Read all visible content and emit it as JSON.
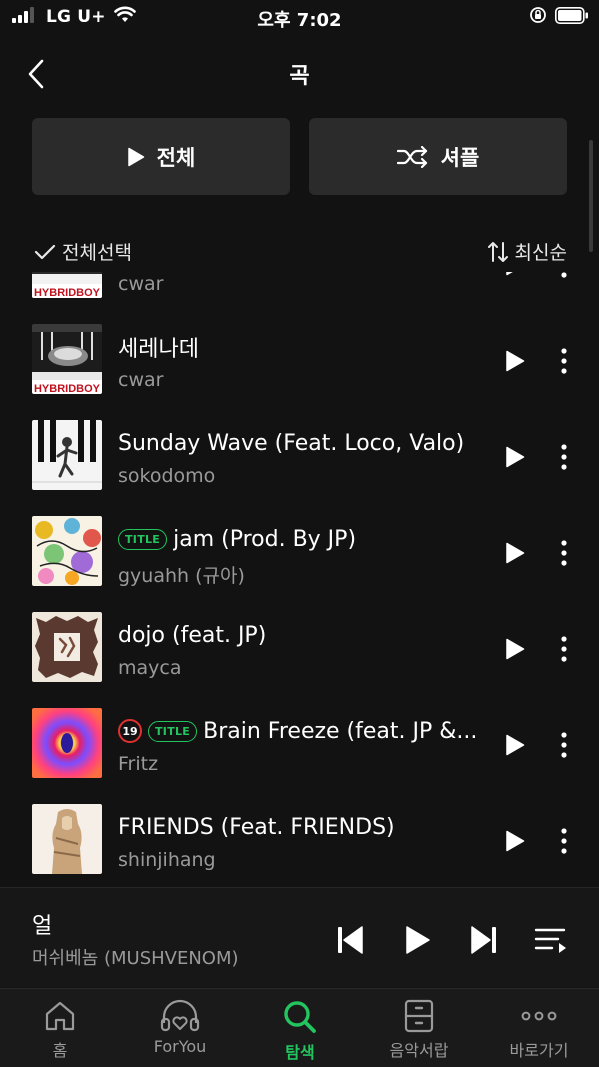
{
  "status_bar": {
    "carrier": "LG U+",
    "time": "오후 7:02"
  },
  "header": {
    "title": "곡"
  },
  "actions": {
    "play_all": "전체",
    "shuffle": "셔플"
  },
  "toolbar": {
    "select_all": "전체선택",
    "sort": "최신순"
  },
  "songs": [
    {
      "title": "",
      "artist": "cwar",
      "title_badge": false,
      "adult": false
    },
    {
      "title": "세레나데",
      "artist": "cwar",
      "title_badge": false,
      "adult": false
    },
    {
      "title": "Sunday Wave (Feat. Loco, Valo)",
      "artist": "sokodomo",
      "title_badge": false,
      "adult": false
    },
    {
      "title": "jam (Prod. By JP)",
      "artist": "gyuahh (규아)",
      "title_badge": true,
      "adult": false
    },
    {
      "title": "dojo (feat. JP)",
      "artist": "mayca",
      "title_badge": false,
      "adult": false
    },
    {
      "title": "Brain Freeze (feat. JP &...",
      "artist": "Fritz",
      "title_badge": true,
      "adult": true
    },
    {
      "title": "FRIENDS (Feat. FRIENDS)",
      "artist": "shinjihang",
      "title_badge": false,
      "adult": false
    }
  ],
  "badges": {
    "title_badge": "TITLE",
    "adult": "19"
  },
  "mini_player": {
    "title": "얼",
    "artist": "머쉬베놈 (MUSHVENOM)"
  },
  "tabs": [
    {
      "label": "홈",
      "icon": "home-icon",
      "active": false
    },
    {
      "label": "ForYou",
      "icon": "headphones-heart-icon",
      "active": false
    },
    {
      "label": "탐색",
      "icon": "search-icon",
      "active": true
    },
    {
      "label": "음악서랍",
      "icon": "drawer-icon",
      "active": false
    },
    {
      "label": "바로가기",
      "icon": "more-dots-icon",
      "active": false
    }
  ],
  "colors": {
    "background": "#121212",
    "accent": "#22c55e",
    "button_bg": "#2b2b2b",
    "secondary_text": "#9a9a9a",
    "adult_badge": "#e03131"
  }
}
